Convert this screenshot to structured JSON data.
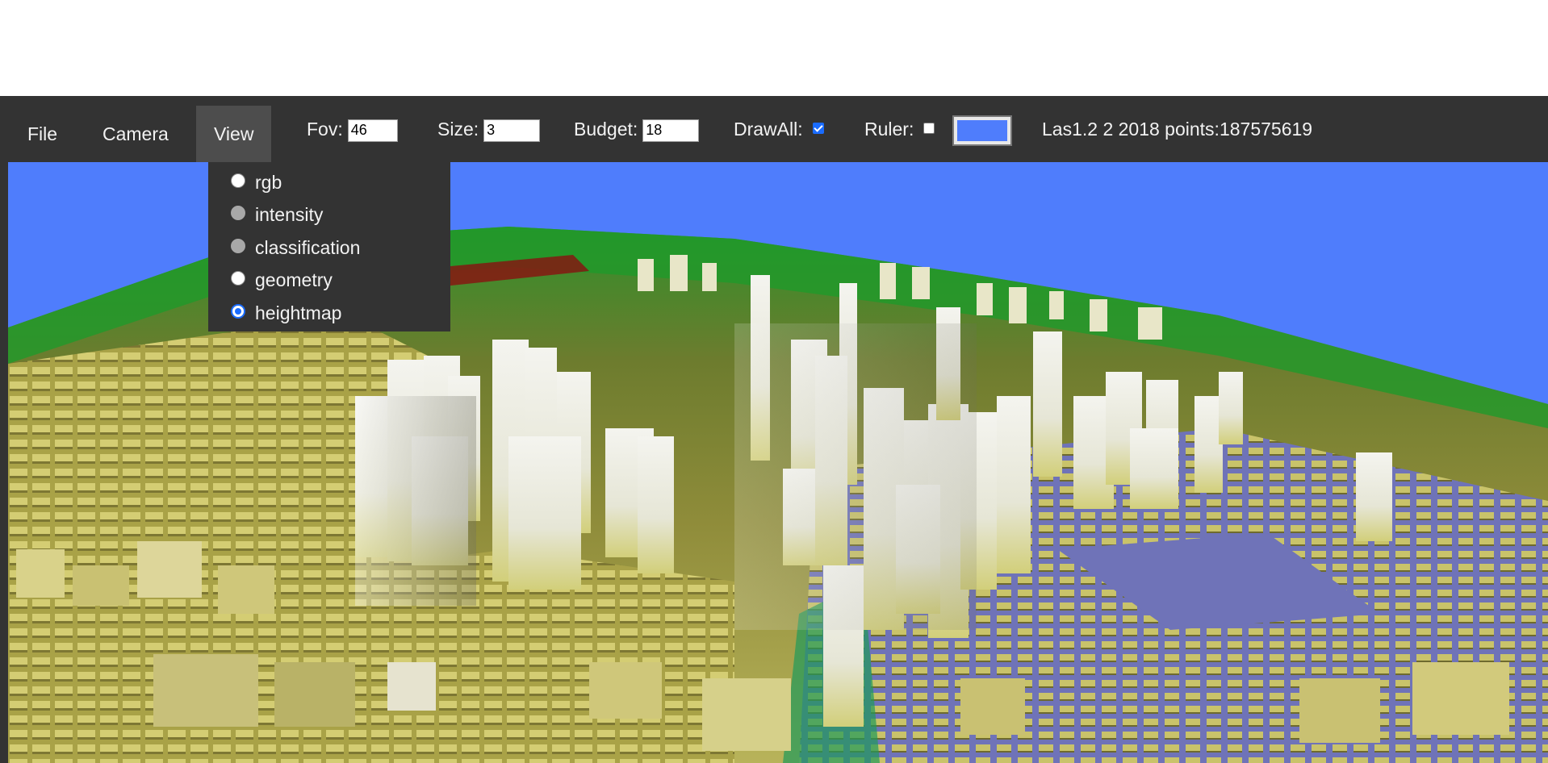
{
  "menu": {
    "file": "File",
    "camera": "Camera",
    "view": "View"
  },
  "controls": {
    "fov_label": "Fov:",
    "fov_value": "46",
    "size_label": "Size:",
    "size_value": "3",
    "budget_label": "Budget:",
    "budget_value": "18",
    "drawall_label": "DrawAll:",
    "drawall_checked": true,
    "ruler_label": "Ruler:",
    "ruler_checked": false,
    "color_swatch": "#4f7dfc"
  },
  "status": {
    "text": "Las1.2 2 2018 points:187575619"
  },
  "view_menu": {
    "options": [
      {
        "label": "rgb",
        "state": "enabled"
      },
      {
        "label": "intensity",
        "state": "disabled"
      },
      {
        "label": "classification",
        "state": "disabled"
      },
      {
        "label": "geometry",
        "state": "enabled"
      },
      {
        "label": "heightmap",
        "state": "selected"
      }
    ]
  },
  "colors": {
    "toolbar_bg": "#333333",
    "sky": "#4f7dfc",
    "accent": "#1a6cff"
  }
}
